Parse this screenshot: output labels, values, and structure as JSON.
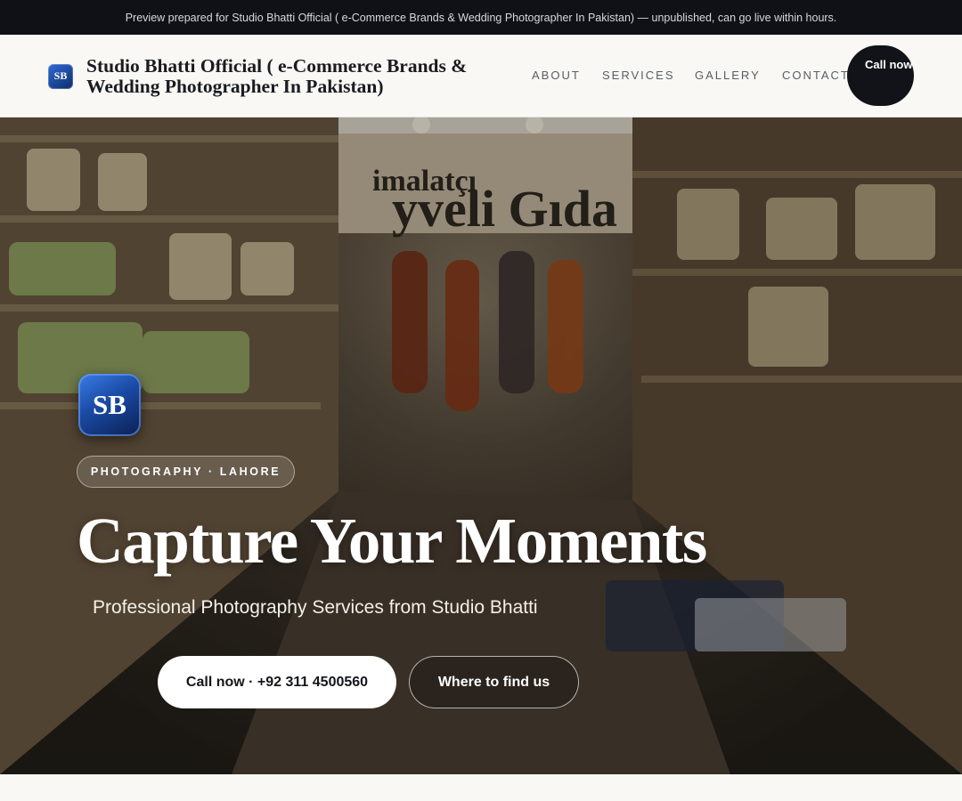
{
  "preview_bar": {
    "text": "Preview prepared for Studio Bhatti Official ( e-Commerce Brands & Wedding Photographer In Pakistan) — unpublished, can go live within hours."
  },
  "header": {
    "logo_initials": "SB",
    "brand_name": "Studio Bhatti Official ( e-Commerce Brands & Wedding Photographer In Pakistan)",
    "nav": [
      {
        "label": "ABOUT"
      },
      {
        "label": "SERVICES"
      },
      {
        "label": "GALLERY"
      },
      {
        "label": "CONTACT"
      }
    ],
    "call_button": "Call now"
  },
  "hero": {
    "background_image": "spice-and-grocery-shop-interior",
    "shop_sign": "imalatçı yveli Gıda",
    "logo_initials": "SB",
    "tag": "PHOTOGRAPHY · LAHORE",
    "title": "Capture Your Moments",
    "subtitle": "Professional Photography Services from Studio Bhatti",
    "primary_button": "Call now · +92 311 4500560",
    "secondary_button": "Where to find us"
  },
  "colors": {
    "preview_bar_bg": "#0f1117",
    "header_bg": "#f9f8f5",
    "accent_blue": "#1a4aa3",
    "dark_button": "#121319"
  }
}
